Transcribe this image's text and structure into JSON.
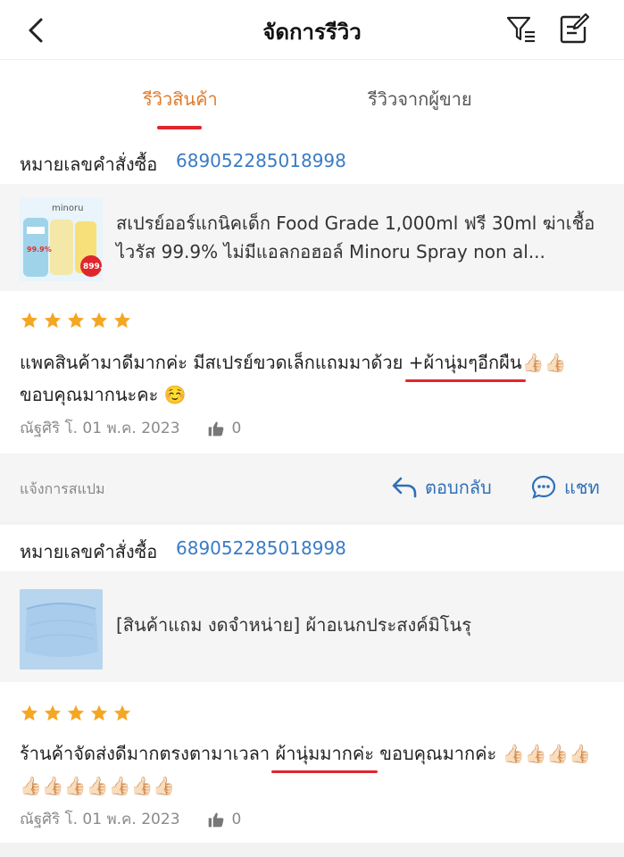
{
  "header": {
    "title": "จัดการรีวิว"
  },
  "tabs": {
    "products": "รีวิวสินค้า",
    "seller": "รีวิวจากผู้ขาย",
    "active": "products"
  },
  "colors": {
    "active_tab": "#e07a2a",
    "tab_indicator": "#e0262d",
    "link_blue": "#3a7cc4",
    "star": "#f5a623",
    "highlight_underline": "#e0262d"
  },
  "reviews": [
    {
      "order_label": "หมายเลขคำสั่งซื้อ",
      "order_number": "689052285018998",
      "product_title": "สเปรย์ออร์แกนิคเด็ก Food Grade 1,000ml ฟรี 30ml ฆ่าเชื้อไวรัส 99.9% ไม่มีแอลกอฮอล์ Minoru Spray non al...",
      "thumb_brand": "minoru",
      "thumb_badge": "99.9%",
      "thumb_price": "899.",
      "rating": 5,
      "text_before": "แพคสินค้ามาดีมากค่ะ มีสเปรย์ขวดเล็กแถมมาด้วย ",
      "text_highlight": "+ผ้านุ่มๆอีกผืน",
      "text_after": "👍🏻👍🏻 ขอบคุณมากนะคะ ☺️",
      "reviewer_date": "ณัฐศิริ โ. 01 พ.ค. 2023",
      "likes": "0"
    },
    {
      "order_label": "หมายเลขคำสั่งซื้อ",
      "order_number": "689052285018998",
      "product_title": "[สินค้าแถม งดจำหน่าย] ผ้าอเนกประสงค์มิโนรุ",
      "rating": 5,
      "text_before": "ร้านค้าจัดส่งดีมากตรงตามาเวลา ",
      "text_highlight": "ผ้านุ่มมากค่ะ",
      "text_after": " ขอบคุณมากค่ะ 👍🏻👍🏻👍🏻👍🏻👍🏻👍🏻👍🏻👍🏻👍🏻👍🏻👍🏻",
      "reviewer_date": "ณัฐศิริ โ. 01 พ.ค. 2023",
      "likes": "0"
    }
  ],
  "actions": {
    "report": "แจ้งการสแปม",
    "reply": "ตอบกลับ",
    "chat": "แชท"
  }
}
